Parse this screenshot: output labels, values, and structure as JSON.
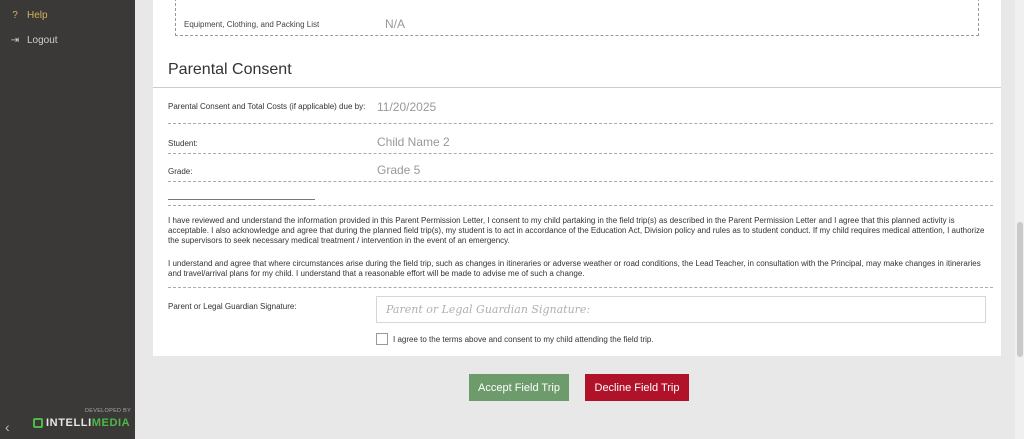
{
  "sidebar": {
    "help_label": "Help",
    "logout_label": "Logout",
    "developed_by": "DEVELOPED BY",
    "brand_part1": "INTELLI",
    "brand_part2": "MEDIA"
  },
  "icons": {
    "help": "question-mark-icon",
    "logout": "logout-icon",
    "collapse": "chevron-left-icon"
  },
  "previous_section": {
    "label": "Equipment, Clothing, and Packing List",
    "value": "N/A"
  },
  "consent": {
    "title": "Parental Consent",
    "fields": [
      {
        "label": "Parental Consent and Total Costs (if applicable) due by:",
        "value": "11/20/2025"
      },
      {
        "label": "Student:",
        "value": "Child Name 2"
      },
      {
        "label": "Grade:",
        "value": "Grade 5"
      }
    ],
    "paragraph1": "I have reviewed and understand the information provided in this Parent Permission Letter, I consent to my child partaking in the field trip(s) as described in the Parent Permission Letter and I agree that this planned activity is acceptable. I also acknowledge and agree that during the planned field trip(s), my student is to act in accordance of the Education Act, Division policy and rules as to student conduct. If my child requires medical attention, I authorize the supervisors to seek necessary medical treatment / intervention in the event of an emergency.",
    "paragraph2": "I understand and agree that where circumstances arise during the field trip, such as changes in itineraries or adverse weather or road conditions, the Lead Teacher, in consultation with the Principal, may make changes in itineraries and travel/arrival plans for my child. I understand that a reasonable effort will be made to advise me of such a change.",
    "signature_label": "Parent or Legal Guardian Signature:",
    "signature_placeholder": "Parent or Legal Guardian Signature:",
    "signature_value": "",
    "agree_text": "I agree to the terms above and consent to my child attending the field trip.",
    "agree_checked": false
  },
  "actions": {
    "accept_label": "Accept Field Trip",
    "decline_label": "Decline Field Trip"
  },
  "colors": {
    "sidebar_bg": "#3b3937",
    "help_accent": "#d5b25a",
    "brand_green": "#4fb848",
    "accept_green": "#6d9b6b",
    "decline_red": "#b0122a"
  }
}
